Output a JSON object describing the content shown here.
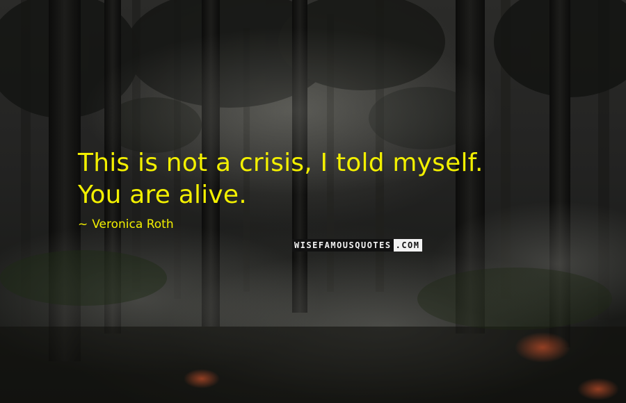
{
  "quote": {
    "line1": "This is not a crisis, I told myself.",
    "line2": "You are alive.",
    "color": "#f3f000"
  },
  "author": {
    "dash": "~",
    "name": "Veronica Roth"
  },
  "watermark": {
    "text_left": "WISEFAMOUSQUOTES",
    "text_right": ".COM"
  }
}
